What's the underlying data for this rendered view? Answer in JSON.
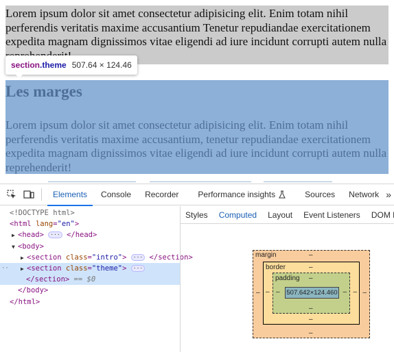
{
  "page": {
    "intro_text": "Lorem ipsum dolor sit amet consectetur adipisicing elit. Enim totam nihil perferendis veritatis maxime accusantium Tenetur repudiandae exercitationem expedita magnam dignissimos vitae eligendi ad iure incidunt corrupti autem nulla reprehenderit!",
    "theme_title": "Les marges",
    "theme_text": "Lorem ipsum dolor sit amet consectetur adipisicing elit. Enim totam nihil perferendis veritatis maxime accusantium, tenetur repudiandae exercitationem expedita magnam dignissimos vitae eligendi ad iure incidunt corrupti autem nulla reprehenderit!",
    "colors": {
      "intro_bg": "#cbcbcb",
      "theme_bg": "#8db0d8",
      "theme_text": "#4e6f97"
    }
  },
  "tooltip": {
    "tag": "section",
    "class": ".theme",
    "size": "507.64 × 124.46"
  },
  "devtools": {
    "icons": [
      "inspect-element-icon",
      "device-toggle-icon"
    ],
    "tabs": [
      "Elements",
      "Console",
      "Recorder",
      "Performance insights",
      "Sources",
      "Network"
    ],
    "active_tab": "Elements",
    "more_tabs": "»",
    "dom": {
      "doctype": "<!DOCTYPE html>",
      "html_open_tag": "<html",
      "html_lang_attr": "lang",
      "html_lang_val": "\"en\"",
      "head_open": "<head>",
      "head_close": "</head>",
      "body_open": "<body>",
      "section_open": "<section",
      "class_attr": "class",
      "intro_val": "\"intro\"",
      "theme_val": "\"theme\"",
      "section_close": "</section>",
      "dollar_zero": "== $0",
      "body_close": "</body>",
      "html_close": "</html>",
      "ellipsis": "···",
      "gt": ">",
      "eq": "="
    },
    "subtabs": [
      "Styles",
      "Computed",
      "Layout",
      "Event Listeners",
      "DOM Br"
    ],
    "active_subtab": "Computed",
    "box_model": {
      "margin_label": "margin",
      "border_label": "border",
      "padding_label": "padding",
      "dash": "–",
      "content_size": "507.642×124.460",
      "colors": {
        "margin": "#f9cc9d",
        "border": "#fddd9b",
        "padding": "#c3d08b",
        "content": "#8cb6c0"
      }
    }
  }
}
